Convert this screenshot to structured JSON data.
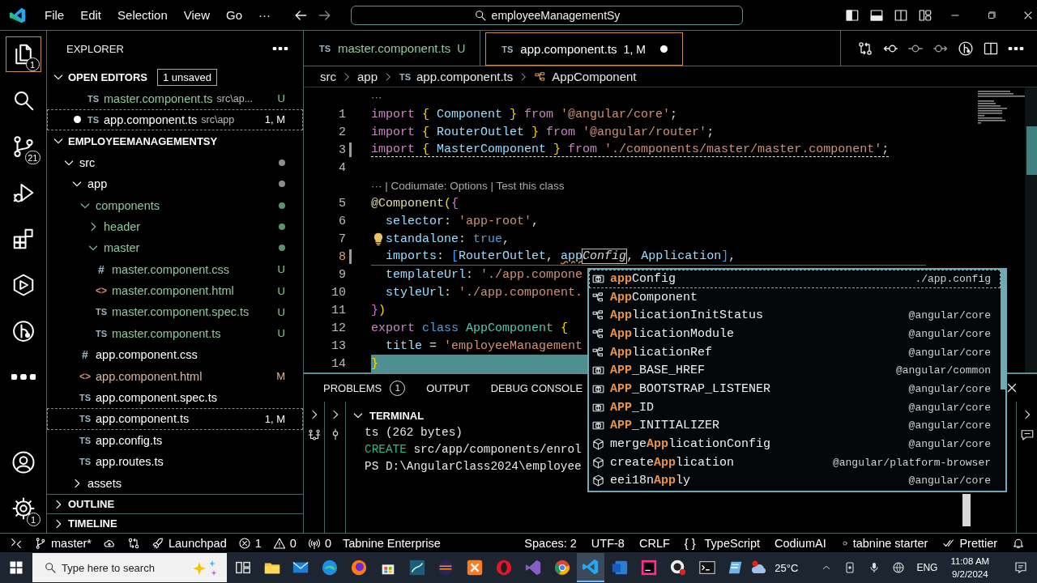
{
  "title_bar": {
    "menu": [
      "File",
      "Edit",
      "Selection",
      "View",
      "Go",
      "···"
    ],
    "search": "employeeManagementSy"
  },
  "activity_bar": {
    "items": [
      {
        "kind": "explorer",
        "badge": "1",
        "selected": true
      },
      {
        "kind": "search",
        "selected": false
      },
      {
        "kind": "source-control",
        "badge": "21",
        "selected": false
      },
      {
        "kind": "run-debug",
        "selected": false
      },
      {
        "kind": "extensions",
        "selected": false
      },
      {
        "kind": "remote",
        "selected": false
      },
      {
        "kind": "git-graph",
        "selected": false
      },
      {
        "kind": "more",
        "selected": false
      }
    ],
    "bottom": [
      {
        "kind": "account",
        "selected": false
      },
      {
        "kind": "settings",
        "badge": "1",
        "selected": false
      }
    ]
  },
  "sidebar": {
    "title": "EXPLORER",
    "open_editors": {
      "title": "OPEN EDITORS",
      "expanded": true,
      "badge": "1 unsaved",
      "items": [
        {
          "icon": "TS",
          "kind": "ts",
          "name": "master.component.ts",
          "path": "src\\ap...",
          "badge": "U",
          "untracked": true,
          "modified": false,
          "dirty": false,
          "selected": false
        },
        {
          "icon": "TS",
          "kind": "ts",
          "name": "app.component.ts",
          "path": "src\\app",
          "badge": "1, M",
          "untracked": false,
          "modified": false,
          "dirty": true,
          "selected": true
        }
      ]
    },
    "project": {
      "title": "EMPLOYEEMANAGEMENTSY",
      "expanded": true,
      "tree": [
        {
          "kind": "folder",
          "name": "src",
          "expanded": true,
          "dot": true,
          "untracked": false,
          "modified": false,
          "selected": false,
          "children": [
            {
              "kind": "folder",
              "name": "app",
              "expanded": true,
              "dot": true,
              "untracked": false,
              "modified": false,
              "selected": false,
              "children": [
                {
                  "kind": "folder",
                  "name": "components",
                  "expanded": true,
                  "dot": true,
                  "untracked": true,
                  "modified": false,
                  "selected": false,
                  "children": [
                    {
                      "kind": "folder",
                      "name": "header",
                      "expanded": false,
                      "dot": true,
                      "untracked": true,
                      "modified": false,
                      "selected": false
                    },
                    {
                      "kind": "folder",
                      "name": "master",
                      "expanded": true,
                      "dot": true,
                      "untracked": true,
                      "modified": false,
                      "selected": false,
                      "children": [
                        {
                          "kind": "css",
                          "icon": "#",
                          "name": "master.component.css",
                          "badge": "U",
                          "untracked": true,
                          "modified": false,
                          "selected": false
                        },
                        {
                          "kind": "html",
                          "icon": "<>",
                          "name": "master.component.html",
                          "badge": "U",
                          "untracked": true,
                          "modified": false,
                          "selected": false
                        },
                        {
                          "kind": "ts",
                          "icon": "TS",
                          "name": "master.component.spec.ts",
                          "badge": "U",
                          "untracked": true,
                          "modified": false,
                          "selected": false
                        },
                        {
                          "kind": "ts",
                          "icon": "TS",
                          "name": "master.component.ts",
                          "badge": "U",
                          "untracked": true,
                          "modified": false,
                          "selected": false
                        }
                      ]
                    }
                  ]
                },
                {
                  "kind": "css",
                  "icon": "#",
                  "name": "app.component.css",
                  "untracked": false,
                  "modified": false,
                  "selected": false
                },
                {
                  "kind": "html",
                  "icon": "<>",
                  "name": "app.component.html",
                  "badge": "M",
                  "untracked": false,
                  "modified": true,
                  "selected": false
                },
                {
                  "kind": "ts",
                  "icon": "TS",
                  "name": "app.component.spec.ts",
                  "untracked": false,
                  "modified": false,
                  "selected": false
                },
                {
                  "kind": "ts",
                  "icon": "TS",
                  "name": "app.component.ts",
                  "badge": "1, M",
                  "untracked": false,
                  "modified": false,
                  "selected": true
                },
                {
                  "kind": "ts",
                  "icon": "TS",
                  "name": "app.config.ts",
                  "untracked": false,
                  "modified": false,
                  "selected": false
                },
                {
                  "kind": "ts",
                  "icon": "TS",
                  "name": "app.routes.ts",
                  "untracked": false,
                  "modified": false,
                  "selected": false
                }
              ]
            },
            {
              "kind": "folder",
              "name": "assets",
              "expanded": false,
              "dot": false,
              "untracked": false,
              "modified": false,
              "selected": false
            }
          ]
        }
      ]
    },
    "sections": [
      {
        "title": "OUTLINE",
        "expanded": false
      },
      {
        "title": "TIMELINE",
        "expanded": false
      }
    ]
  },
  "editor": {
    "tabs": [
      {
        "icon": "TS",
        "name": "master.component.ts",
        "badge": "U",
        "untracked": true,
        "dirty": false,
        "selected": false
      },
      {
        "icon": "TS",
        "name": "app.component.ts",
        "badge": "1, M",
        "untracked": false,
        "dirty": true,
        "selected": true
      }
    ],
    "breadcrumbs": [
      {
        "kind": "folder",
        "text": "src"
      },
      {
        "kind": "folder",
        "text": "app"
      },
      {
        "kind": "ts",
        "icon": "TS",
        "text": "app.component.ts"
      },
      {
        "kind": "class",
        "text": "AppComponent"
      }
    ],
    "lines": [
      {
        "kind": "lens",
        "text": "···"
      },
      {
        "kind": "code",
        "number": "1",
        "modified": false,
        "current": false,
        "underlined": false,
        "lightbulb": false,
        "highlighted": false,
        "tokens": [
          {
            "kind": "kw",
            "text": "import "
          },
          {
            "kind": "br",
            "text": "{ "
          },
          {
            "kind": "id",
            "text": "Component "
          },
          {
            "kind": "br",
            "text": "} "
          },
          {
            "kind": "kw",
            "text": "from "
          },
          {
            "kind": "str",
            "text": "'@angular/core'"
          },
          {
            "kind": "p",
            "text": ";"
          }
        ]
      },
      {
        "kind": "code",
        "number": "2",
        "modified": false,
        "current": false,
        "underlined": false,
        "lightbulb": false,
        "highlighted": false,
        "tokens": [
          {
            "kind": "kw",
            "text": "import "
          },
          {
            "kind": "br",
            "text": "{ "
          },
          {
            "kind": "id",
            "text": "RouterOutlet "
          },
          {
            "kind": "br",
            "text": "} "
          },
          {
            "kind": "kw",
            "text": "from "
          },
          {
            "kind": "str",
            "text": "'@angular/router'"
          },
          {
            "kind": "p",
            "text": ";"
          }
        ]
      },
      {
        "kind": "code",
        "number": "3",
        "modified": true,
        "current": false,
        "underlined": true,
        "lightbulb": false,
        "highlighted": false,
        "tokens": [
          {
            "kind": "kw",
            "text": "import "
          },
          {
            "kind": "br",
            "text": "{ "
          },
          {
            "kind": "id",
            "text": "MasterComponent "
          },
          {
            "kind": "br",
            "text": "} "
          },
          {
            "kind": "kw",
            "text": "from "
          },
          {
            "kind": "str",
            "text": "'./components/master/master.component'"
          },
          {
            "kind": "p",
            "text": ";"
          }
        ]
      },
      {
        "kind": "code",
        "number": "4",
        "modified": false,
        "current": false,
        "underlined": false,
        "lightbulb": false,
        "highlighted": false
      },
      {
        "kind": "lens",
        "text": "··· | Codiumate: Options | Test this class"
      },
      {
        "kind": "code",
        "number": "5",
        "modified": false,
        "current": false,
        "underlined": false,
        "lightbulb": false,
        "highlighted": false,
        "tokens": [
          {
            "kind": "fn",
            "text": "@Component"
          },
          {
            "kind": "br",
            "text": "("
          },
          {
            "kind": "br2",
            "text": "{"
          }
        ]
      },
      {
        "kind": "code",
        "number": "6",
        "modified": false,
        "current": false,
        "underlined": false,
        "lightbulb": false,
        "highlighted": false,
        "tokens": [
          {
            "kind": "id",
            "text": "  selector"
          },
          {
            "kind": "p",
            "text": ": "
          },
          {
            "kind": "str",
            "text": "'app-root'"
          },
          {
            "kind": "p",
            "text": ","
          }
        ]
      },
      {
        "kind": "code",
        "number": "7",
        "modified": false,
        "current": false,
        "underlined": false,
        "lightbulb": true,
        "highlighted": false,
        "tokens": [
          {
            "kind": "id",
            "text": "standalone"
          },
          {
            "kind": "p",
            "text": ": "
          },
          {
            "kind": "const",
            "text": "true"
          },
          {
            "kind": "p",
            "text": ","
          }
        ]
      },
      {
        "kind": "code",
        "number": "8",
        "modified": true,
        "current": true,
        "underlined": false,
        "lightbulb": false,
        "highlighted": false,
        "tokens": [
          {
            "kind": "id",
            "text": "  imports"
          },
          {
            "kind": "p",
            "text": ": "
          },
          {
            "kind": "br3",
            "text": "["
          },
          {
            "kind": "id",
            "text": "RouterOutlet"
          },
          {
            "kind": "p",
            "text": ", "
          },
          {
            "kind": "err",
            "text": "app"
          },
          {
            "kind": "ghost",
            "text": "Config"
          },
          {
            "kind": "p",
            "text": ", "
          },
          {
            "kind": "id",
            "text": "Application"
          },
          {
            "kind": "br3",
            "text": "]"
          },
          {
            "kind": "p",
            "text": ","
          }
        ]
      },
      {
        "kind": "code",
        "number": "9",
        "modified": false,
        "current": false,
        "underlined": false,
        "lightbulb": false,
        "highlighted": false,
        "tokens": [
          {
            "kind": "id",
            "text": "  templateUrl"
          },
          {
            "kind": "p",
            "text": ": "
          },
          {
            "kind": "str",
            "text": "'./app.compone"
          }
        ]
      },
      {
        "kind": "code",
        "number": "10",
        "modified": false,
        "current": false,
        "underlined": false,
        "lightbulb": false,
        "highlighted": false,
        "tokens": [
          {
            "kind": "id",
            "text": "  styleUrl"
          },
          {
            "kind": "p",
            "text": ": "
          },
          {
            "kind": "str",
            "text": "'./app.component."
          }
        ]
      },
      {
        "kind": "code",
        "number": "11",
        "modified": false,
        "current": false,
        "underlined": false,
        "lightbulb": false,
        "highlighted": false,
        "tokens": [
          {
            "kind": "br2",
            "text": "}"
          },
          {
            "kind": "br",
            "text": ")"
          }
        ]
      },
      {
        "kind": "code",
        "number": "12",
        "modified": false,
        "current": false,
        "underlined": false,
        "lightbulb": false,
        "highlighted": false,
        "tokens": [
          {
            "kind": "kw",
            "text": "export "
          },
          {
            "kind": "const",
            "text": "class "
          },
          {
            "kind": "cls",
            "text": "AppComponent "
          },
          {
            "kind": "br",
            "text": "{"
          }
        ]
      },
      {
        "kind": "code",
        "number": "13",
        "modified": false,
        "current": false,
        "underlined": false,
        "lightbulb": false,
        "highlighted": false,
        "tokens": [
          {
            "kind": "id",
            "text": "  title"
          },
          {
            "kind": "p",
            "text": " = "
          },
          {
            "kind": "str",
            "text": "'employeeManagement"
          }
        ]
      },
      {
        "kind": "code",
        "number": "14",
        "modified": false,
        "current": false,
        "underlined": false,
        "lightbulb": false,
        "highlighted": true,
        "tokens": [
          {
            "kind": "br",
            "text": "}"
          }
        ]
      }
    ]
  },
  "suggestions": [
    {
      "kind": "variable",
      "parts": [
        {
          "text": "app",
          "match": true
        },
        {
          "text": "Config",
          "match": false
        }
      ],
      "detail": "./app.config",
      "selected": true
    },
    {
      "kind": "class",
      "parts": [
        {
          "text": "App",
          "match": true
        },
        {
          "text": "Component",
          "match": false
        }
      ],
      "selected": false
    },
    {
      "kind": "class",
      "parts": [
        {
          "text": "App",
          "match": true
        },
        {
          "text": "licationInitStatus",
          "match": false
        }
      ],
      "detail": "@angular/core",
      "selected": false
    },
    {
      "kind": "class",
      "parts": [
        {
          "text": "App",
          "match": true
        },
        {
          "text": "licationModule",
          "match": false
        }
      ],
      "detail": "@angular/core",
      "selected": false
    },
    {
      "kind": "class",
      "parts": [
        {
          "text": "App",
          "match": true
        },
        {
          "text": "licationRef",
          "match": false
        }
      ],
      "detail": "@angular/core",
      "selected": false
    },
    {
      "kind": "variable",
      "parts": [
        {
          "text": "APP",
          "match": true
        },
        {
          "text": "_BASE_HREF",
          "match": false
        }
      ],
      "detail": "@angular/common",
      "selected": false
    },
    {
      "kind": "variable",
      "parts": [
        {
          "text": "APP",
          "match": true
        },
        {
          "text": "_BOOTSTRAP_LISTENER",
          "match": false
        }
      ],
      "detail": "@angular/core",
      "selected": false
    },
    {
      "kind": "variable",
      "parts": [
        {
          "text": "APP",
          "match": true
        },
        {
          "text": "_ID",
          "match": false
        }
      ],
      "detail": "@angular/core",
      "selected": false
    },
    {
      "kind": "variable",
      "parts": [
        {
          "text": "APP",
          "match": true
        },
        {
          "text": "_INITIALIZER",
          "match": false
        }
      ],
      "detail": "@angular/core",
      "selected": false
    },
    {
      "kind": "method",
      "parts": [
        {
          "text": "merge",
          "match": false
        },
        {
          "text": "App",
          "match": true
        },
        {
          "text": "licationConfig",
          "match": false
        }
      ],
      "detail": "@angular/core",
      "selected": false
    },
    {
      "kind": "method",
      "parts": [
        {
          "text": "create",
          "match": false
        },
        {
          "text": "App",
          "match": true
        },
        {
          "text": "lication",
          "match": false
        }
      ],
      "detail": "@angular/platform-browser",
      "selected": false
    },
    {
      "kind": "method",
      "parts": [
        {
          "text": "eei18n",
          "match": false
        },
        {
          "text": "App",
          "match": true
        },
        {
          "text": "ly",
          "match": false
        }
      ],
      "detail": "@angular/core",
      "selected": false
    }
  ],
  "panel": {
    "tabs": [
      {
        "label": "PROBLEMS",
        "badge": "1",
        "selected": false
      },
      {
        "label": "OUTPUT",
        "selected": false
      },
      {
        "label": "DEBUG CONSOLE",
        "selected": false
      }
    ],
    "terminal": {
      "title": "TERMINAL",
      "expanded": true,
      "lines": [
        {
          "tokens": [
            {
              "kind": "plain",
              "text": "ts (262 bytes)"
            }
          ]
        },
        {
          "tokens": [
            {
              "kind": "create",
              "text": "CREATE"
            },
            {
              "kind": "plain",
              "text": " src/app/components/enrol"
            }
          ]
        },
        {
          "tokens": [
            {
              "kind": "plain",
              "text": "PS D:\\AngularClass2024\\employee"
            }
          ]
        }
      ]
    }
  },
  "status_bar": {
    "left": [
      {
        "kind": "remote"
      },
      {
        "kind": "branch",
        "text": "master*"
      },
      {
        "kind": "sync"
      },
      {
        "kind": "compare"
      },
      {
        "kind": "launchpad",
        "text": "Launchpad"
      },
      {
        "kind": "errors",
        "text": "1"
      },
      {
        "kind": "warnings",
        "text": "0"
      },
      {
        "kind": "ports",
        "text": "0"
      },
      {
        "kind": "text",
        "text": "Tabnine Enterprise"
      }
    ],
    "right": [
      {
        "kind": "text",
        "text": "Spaces: 2"
      },
      {
        "kind": "text",
        "text": "UTF-8"
      },
      {
        "kind": "text",
        "text": "CRLF"
      },
      {
        "kind": "language",
        "glyph": "{ }",
        "text": "TypeScript"
      },
      {
        "kind": "text",
        "text": "CodiumAI"
      },
      {
        "kind": "tabnine",
        "text": "tabnine starter"
      },
      {
        "kind": "prettier",
        "text": "Prettier"
      },
      {
        "kind": "bell"
      }
    ]
  },
  "taskbar": {
    "search": {
      "placeholder": "Type here to search"
    },
    "apps": [
      {
        "kind": "task-view",
        "selected": false
      },
      {
        "kind": "files",
        "selected": false
      },
      {
        "kind": "mail",
        "selected": false
      },
      {
        "kind": "edge",
        "selected": false
      },
      {
        "kind": "firefox",
        "selected": false
      },
      {
        "kind": "store",
        "selected": false
      },
      {
        "kind": "db",
        "selected": false
      },
      {
        "kind": "eclipse",
        "selected": false
      },
      {
        "kind": "xampp",
        "selected": false
      },
      {
        "kind": "opera",
        "selected": false
      },
      {
        "kind": "visual-studio",
        "selected": false
      },
      {
        "kind": "chrome",
        "selected": false
      },
      {
        "kind": "vscode",
        "selected": true
      },
      {
        "kind": "word",
        "selected": false
      },
      {
        "kind": "jetbrains",
        "selected": false
      },
      {
        "kind": "recorder",
        "selected": false
      },
      {
        "kind": "terminal",
        "selected": false
      },
      {
        "kind": "notes",
        "selected": false
      }
    ],
    "weather": "25°C",
    "language": "ENG",
    "time": "11:08 AM",
    "date": "9/2/2024"
  }
}
